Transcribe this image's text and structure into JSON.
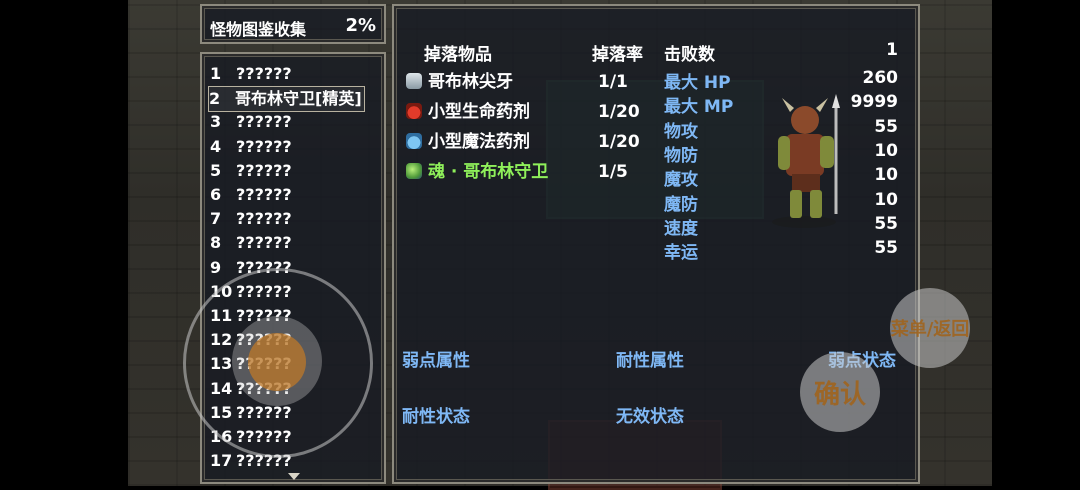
{
  "title": {
    "label": "怪物图鉴收集",
    "percent": "2%"
  },
  "monster_list": [
    {
      "num": "1",
      "name": "??????"
    },
    {
      "num": "2",
      "name": "哥布林守卫[精英]"
    },
    {
      "num": "3",
      "name": "??????"
    },
    {
      "num": "4",
      "name": "??????"
    },
    {
      "num": "5",
      "name": "??????"
    },
    {
      "num": "6",
      "name": "??????"
    },
    {
      "num": "7",
      "name": "??????"
    },
    {
      "num": "8",
      "name": "??????"
    },
    {
      "num": "9",
      "name": "??????"
    },
    {
      "num": "10",
      "name": "??????"
    },
    {
      "num": "11",
      "name": "??????"
    },
    {
      "num": "12",
      "name": "??????"
    },
    {
      "num": "13",
      "name": "??????"
    },
    {
      "num": "14",
      "name": "??????"
    },
    {
      "num": "15",
      "name": "??????"
    },
    {
      "num": "16",
      "name": "??????"
    },
    {
      "num": "17",
      "name": "??????"
    }
  ],
  "detail": {
    "drops_header": "掉落物品",
    "rate_header": "掉落率",
    "defeats_label": "击败数",
    "defeats_value": "1",
    "drops": [
      {
        "icon": "fang-icon",
        "name": "哥布林尖牙",
        "rate": "1/1",
        "color": "#ffffff"
      },
      {
        "icon": "red-potion-icon",
        "name": "小型生命药剂",
        "rate": "1/20",
        "color": "#ffffff"
      },
      {
        "icon": "blue-potion-icon",
        "name": "小型魔法药剂",
        "rate": "1/20",
        "color": "#ffffff"
      },
      {
        "icon": "soul-orb-icon",
        "name": "魂 · 哥布林守卫",
        "rate": "1/5",
        "color": "#8ff05a"
      }
    ],
    "stats": [
      {
        "label": "最大 HP",
        "value": "260"
      },
      {
        "label": "最大 MP",
        "value": "9999"
      },
      {
        "label": "物攻",
        "value": "55"
      },
      {
        "label": "物防",
        "value": "10"
      },
      {
        "label": "魔攻",
        "value": "10"
      },
      {
        "label": "魔防",
        "value": "10"
      },
      {
        "label": "速度",
        "value": "55"
      },
      {
        "label": "幸运",
        "value": "55"
      }
    ],
    "sections": {
      "weak_attr": "弱点属性",
      "resist_attr": "耐性属性",
      "weak_state": "弱点状态",
      "resist_state": "耐性状态",
      "immune_state": "无效状态"
    }
  },
  "controls": {
    "menu_back": "菜单/返回",
    "confirm": "确认"
  },
  "colors": {
    "stat_label": "#7fb8f5",
    "soul_item": "#8ff05a",
    "panel_border": "#8d8a7e"
  }
}
